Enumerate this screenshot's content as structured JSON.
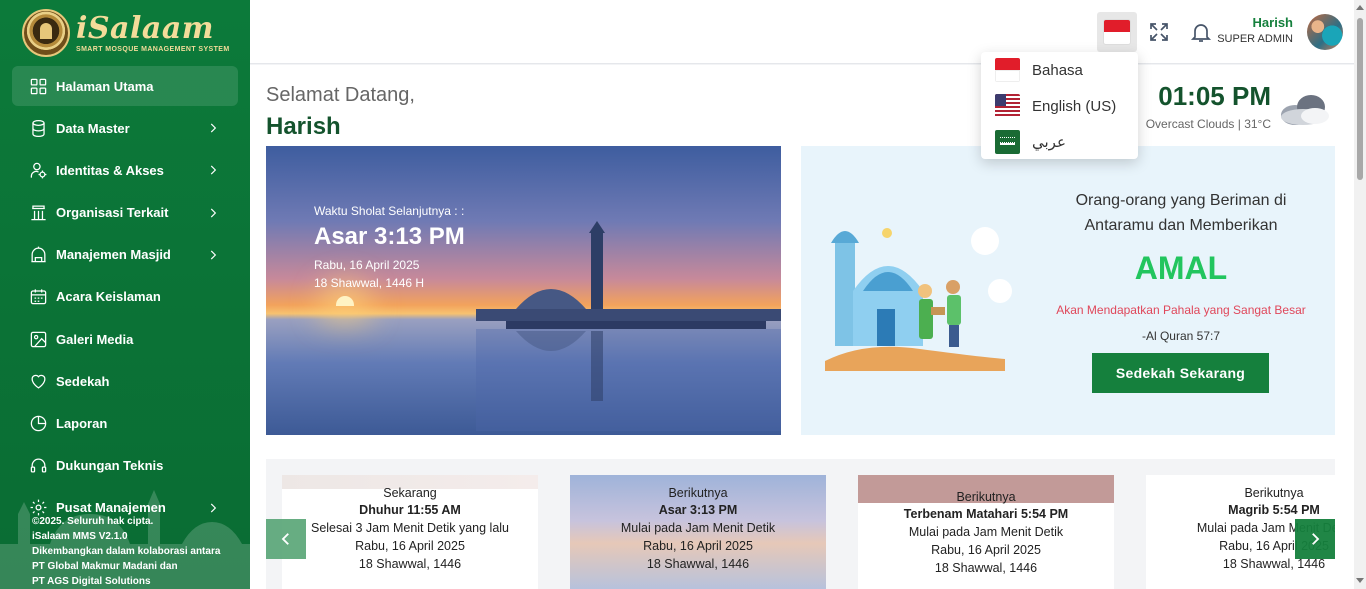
{
  "brand": {
    "name": "iSalaam",
    "tagline": "SMART MOSQUE MANAGEMENT SYSTEM"
  },
  "sidebar": {
    "items": [
      {
        "label": "Halaman Utama",
        "icon": "grid-icon",
        "active": true,
        "has_chevron": false
      },
      {
        "label": "Data Master",
        "icon": "database-icon",
        "has_chevron": true
      },
      {
        "label": "Identitas & Akses",
        "icon": "user-gear-icon",
        "has_chevron": true
      },
      {
        "label": "Organisasi Terkait",
        "icon": "building-icon",
        "has_chevron": true
      },
      {
        "label": "Manajemen Masjid",
        "icon": "mosque-icon",
        "has_chevron": true
      },
      {
        "label": "Acara Keislaman",
        "icon": "calendar-icon",
        "has_chevron": false
      },
      {
        "label": "Galeri Media",
        "icon": "image-icon",
        "has_chevron": false
      },
      {
        "label": "Sedekah",
        "icon": "heart-icon",
        "has_chevron": false
      },
      {
        "label": "Laporan",
        "icon": "pie-chart-icon",
        "has_chevron": false
      },
      {
        "label": "Dukungan Teknis",
        "icon": "headset-icon",
        "has_chevron": false
      },
      {
        "label": "Pusat Manajemen",
        "icon": "settings-icon",
        "has_chevron": true
      }
    ],
    "footer": [
      "©2025. Seluruh hak cipta.",
      "iSalaam MMS V2.1.0",
      "Dikembangkan dalam kolaborasi antara",
      "PT Global Makmur Madani dan",
      "PT AGS Digital Solutions"
    ]
  },
  "header": {
    "user_name": "Harish",
    "user_role": "SUPER ADMIN",
    "icons": [
      "indonesia-flag-icon",
      "fullscreen-icon",
      "bell-icon"
    ]
  },
  "language_menu": {
    "options": [
      {
        "label": "Bahasa",
        "flag": "indonesia-flag-icon"
      },
      {
        "label": "English (US)",
        "flag": "us-flag-icon"
      },
      {
        "label": "عربي",
        "flag": "saudi-flag-icon"
      }
    ]
  },
  "welcome": {
    "greeting": "Selamat Datang,",
    "name": "Harish"
  },
  "clock": {
    "time": "01:05 PM",
    "weather": "Overcast Clouds | 31°C"
  },
  "hero": {
    "label": "Waktu Sholat Selanjutnya : :",
    "prayer_time": "Asar 3:13 PM",
    "date": "Rabu, 16 April 2025",
    "hijri": "18 Shawwal, 1446 H"
  },
  "amal": {
    "line1": "Orang-orang yang Beriman di",
    "line2": "Antaramu dan Memberikan",
    "headline": "AMAL",
    "reward": "Akan Mendapatkan Pahala yang Sangat Besar",
    "source": "-Al Quran 57:7",
    "button": "Sedekah Sekarang"
  },
  "prayer_cards": [
    {
      "label": "Sekarang",
      "name": "Dhuhur 11:55 AM",
      "status": "Selesai 3 Jam Menit Detik yang lalu",
      "date": "Rabu, 16 April 2025",
      "hijri": "18 Shawwal, 1446"
    },
    {
      "label": "Berikutnya",
      "name": "Asar 3:13 PM",
      "status": "Mulai pada Jam Menit Detik",
      "date": "Rabu, 16 April 2025",
      "hijri": "18 Shawwal, 1446"
    },
    {
      "label": "Berikutnya",
      "name": "Terbenam Matahari 5:54 PM",
      "status": "Mulai pada Jam Menit Detik",
      "date": "Rabu, 16 April 2025",
      "hijri": "18 Shawwal, 1446"
    },
    {
      "label": "Berikutnya",
      "name": "Magrib 5:54 PM",
      "status": "Mulai pada Jam Menit Detik",
      "date": "Rabu, 16 April 2025",
      "hijri": "18 Shawwal, 1446"
    }
  ],
  "colors": {
    "primary": "#0c7a3a",
    "accent": "#22c55e",
    "gold": "#f3dc9a",
    "danger": "#e0475a"
  }
}
